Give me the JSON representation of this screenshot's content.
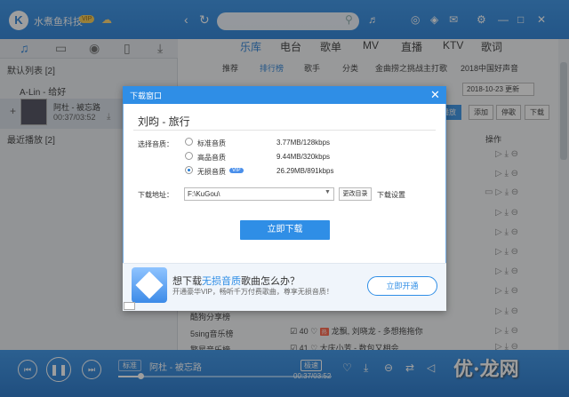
{
  "window": {
    "username": "水煮鱼科技",
    "vip": "VIP"
  },
  "left": {
    "default_list": "默认列表 [2]",
    "artist_song": "A-Lin - 给好",
    "current_song": "阿杜 - 被忘路",
    "current_time": "00:37/03:52",
    "recent": "最近播放 [2]"
  },
  "nav": {
    "items": [
      "乐库",
      "电台",
      "歌单",
      "MV",
      "直播",
      "KTV",
      "歌词"
    ]
  },
  "subnav": {
    "items": [
      "推荐",
      "排行榜",
      "歌手",
      "分类",
      "金曲捞之挑战主打歌",
      "2018中国好声音"
    ]
  },
  "toolbar": {
    "date": "2018-10-23 更新",
    "buttons": [
      "播放",
      "添加",
      "停歌",
      "下载"
    ],
    "op_header": "操作"
  },
  "charts": {
    "items": [
      "酷狗分享榜",
      "5sing音乐榜",
      "繁星音乐榜"
    ],
    "rows": [
      {
        "num": "40",
        "tag": "热",
        "text": "龙飘, 刘晓龙 - 多想拖拖你"
      },
      {
        "num": "41",
        "tag": "",
        "text": "大庆小芳 - 数包又相会"
      }
    ]
  },
  "player": {
    "quality": "标准",
    "title": "阿杜 - 被忘路",
    "time": "00:37/03:52",
    "pquality": "极速"
  },
  "watermark": "优·龙网",
  "dialog": {
    "title": "下载窗口",
    "song": "刘昀 - 旅行",
    "quality_label": "选择音质：",
    "options": [
      {
        "name": "标准音质",
        "size": "3.77MB/128kbps"
      },
      {
        "name": "高品音质",
        "size": "9.44MB/320kbps"
      },
      {
        "name": "无损音质",
        "size": "26.29MB/891kbps"
      }
    ],
    "vip_tag": "VIP",
    "path_label": "下载地址：",
    "path": "F:\\KuGou\\",
    "change_dir": "更改目录",
    "settings": "下载设置",
    "download_button": "立即下载",
    "promo_title_pre": "想下载",
    "promo_title_hl": "无损音质",
    "promo_title_post": "歌曲怎么办？",
    "promo_sub": "开通豪华VIP，畅听千万付费歌曲，尊享无损音质！",
    "open_button": "立即开通"
  },
  "colors": {
    "accent": "#2f8ee6",
    "dark": "#1f7bd6"
  }
}
